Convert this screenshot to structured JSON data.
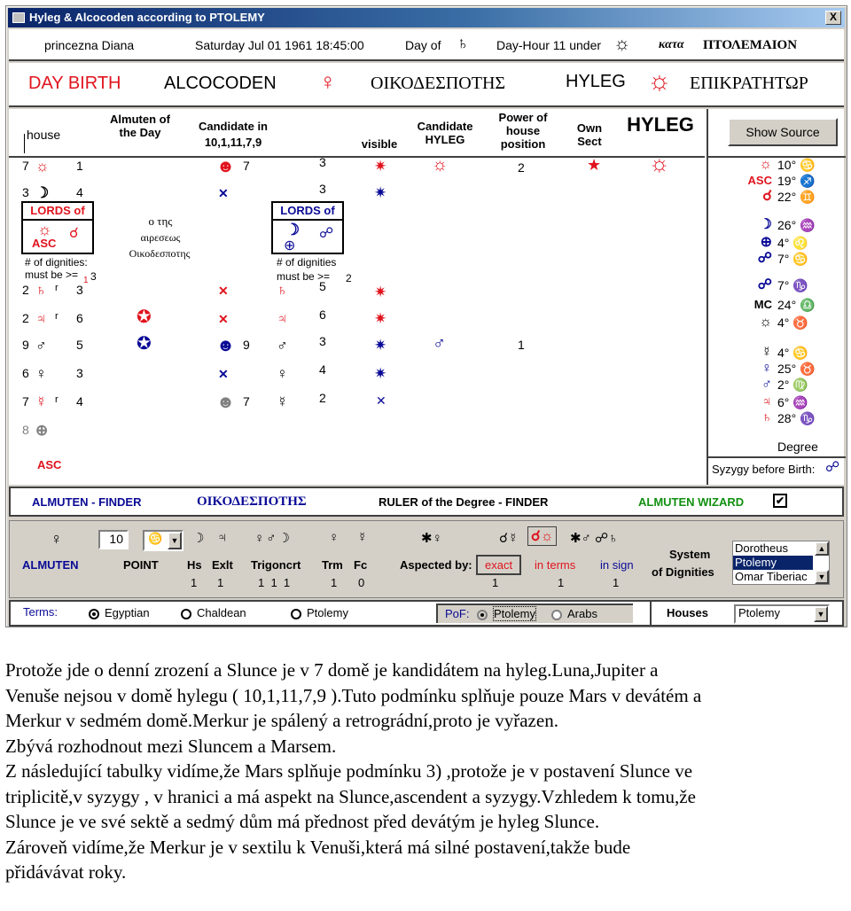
{
  "window": {
    "title": "Hyleg & Alcocoden according to PTOLEMY",
    "close_label": "X"
  },
  "infobar": {
    "name": "princezna Diana",
    "datetime": "Saturday Jul 01 1961 18:45:00",
    "day_of_label": "Day of",
    "day_ruler_icon": "saturn-icon",
    "day_ruler_glyph": "♄",
    "day_hour": "Day-Hour 11 under",
    "hour_ruler_icon": "sun-icon",
    "hour_ruler_glyph": "☼",
    "kata": "κατα",
    "ptolemaion": "ΠΤΟΛΕΜΑΙΟΝ"
  },
  "headbar": {
    "day_birth": "DAY BIRTH",
    "alcocoden": "ALCOCODEN",
    "oikodespotes_icon_glyph": "♀",
    "oikodespotes": "ΟΙΚΟΔΕΣΠΟΤΗΣ",
    "hyleg": "HYLEG",
    "epikratetor_icon_glyph": "☼",
    "epikratetor": "ΕΠΙΚΡΑΤΗΤΩΡ"
  },
  "table": {
    "headers": {
      "house": "house",
      "almuten_day": "Almuten of the Day",
      "candidate_in": "Candidate in",
      "candidate_houses": "10,1,11,7,9",
      "visible": "visible",
      "candidate_hyleg": "Candidate HYLEG",
      "power_house": "Power of house position",
      "own_sect": "Own Sect",
      "hyleg": "HYLEG"
    },
    "show_source_label": "Show Source",
    "lords_of_label": "LORDS of",
    "asc_label": "ASC",
    "dignities_label": "# of dignities:",
    "must_be_left": "must be >=",
    "must_be_left_value": "3",
    "must_be_left_sub": "1",
    "dignities_label_right": "# of dignities",
    "must_be_right": "must be >=",
    "must_be_right_value": "2",
    "greek_1": "ο της",
    "greek_2": "αιρεσεως",
    "greek_3": "Οικοδεσποτης",
    "left_rows": [
      {
        "house": "7",
        "planet": "sun",
        "glyph": "☼",
        "retro": "",
        "score": "1",
        "color": "red"
      },
      {
        "house": "3",
        "planet": "moon",
        "glyph": "☽",
        "retro": "",
        "score": "4",
        "color": "black"
      },
      {
        "house": "2",
        "planet": "saturn",
        "glyph": "♄",
        "retro": "r",
        "score": "3",
        "color": "red"
      },
      {
        "house": "2",
        "planet": "jupiter",
        "glyph": "♃",
        "retro": "r",
        "score": "6",
        "color": "red"
      },
      {
        "house": "9",
        "planet": "mars",
        "glyph": "♂",
        "retro": "",
        "score": "5",
        "color": "black"
      },
      {
        "house": "6",
        "planet": "venus",
        "glyph": "♀",
        "retro": "",
        "score": "3",
        "color": "black"
      },
      {
        "house": "7",
        "planet": "mercury",
        "glyph": "☿",
        "retro": "r",
        "score": "4",
        "color": "red"
      },
      {
        "house": "8",
        "planet": "part-of-fortune",
        "glyph": "⊕",
        "retro": "",
        "score": "",
        "color": "gray"
      }
    ],
    "asc_bottom": "ASC",
    "candidate_rows": [
      {
        "mark": "smiley",
        "house": "7",
        "planet_glyph": "",
        "score": "3"
      },
      {
        "mark": "x",
        "house": "",
        "planet_glyph": "",
        "score": "3"
      },
      {
        "mark": "x",
        "house": "",
        "planet_glyph": "♄",
        "score": "5"
      },
      {
        "mark": "x",
        "house": "",
        "planet_glyph": "♃",
        "score": "6"
      },
      {
        "mark": "smiley",
        "house": "9",
        "planet_glyph": "♂",
        "score": "3"
      },
      {
        "mark": "x",
        "house": "",
        "planet_glyph": "♀",
        "score": "4"
      },
      {
        "mark": "smiley-gray",
        "house": "7",
        "planet_glyph": "☿",
        "score": "2"
      }
    ],
    "candidate_hyleg_row": {
      "glyph": "☼",
      "power": "2",
      "own_sect": "★"
    },
    "mars_candidate": {
      "glyph": "♂",
      "power": "1"
    },
    "positions": [
      {
        "label": "sun",
        "glyph": "☼",
        "degree": "10°",
        "sign": "♋",
        "color": "red"
      },
      {
        "label": "ASC",
        "glyph": "ASC",
        "degree": "19°",
        "sign": "♐",
        "color": "red"
      },
      {
        "label": "new-moon",
        "glyph": "☌",
        "degree": "22°",
        "sign": "♊",
        "color": "red"
      },
      {
        "label": "moon",
        "glyph": "☽",
        "degree": "26°",
        "sign": "♒",
        "color": "blue"
      },
      {
        "label": "part-of-fortune",
        "glyph": "⊕",
        "degree": "4°",
        "sign": "♌",
        "color": "blue"
      },
      {
        "label": "syzygy",
        "glyph": "☍",
        "degree": "7°",
        "sign": "♋",
        "color": "blue"
      },
      {
        "label": "full-moon",
        "glyph": "☍",
        "degree": "7°",
        "sign": "♑",
        "color": "blue"
      },
      {
        "label": "MC",
        "glyph": "MC",
        "degree": "24°",
        "sign": "♎",
        "color": "black"
      },
      {
        "label": "hour-ruler",
        "glyph": "☼",
        "degree": "4°",
        "sign": "♉",
        "color": "black"
      },
      {
        "label": "mercury",
        "glyph": "☿",
        "degree": "4°",
        "sign": "♋",
        "color": "black"
      },
      {
        "label": "venus",
        "glyph": "♀",
        "degree": "25°",
        "sign": "♉",
        "color": "blue"
      },
      {
        "label": "mars",
        "glyph": "♂",
        "degree": "2°",
        "sign": "♍",
        "color": "blue"
      },
      {
        "label": "jupiter",
        "glyph": "♃",
        "degree": "6°",
        "sign": "♒",
        "color": "red"
      },
      {
        "label": "saturn",
        "glyph": "♄",
        "degree": "28°",
        "sign": "♑",
        "color": "red"
      }
    ],
    "degree_label": "Degree",
    "syzygy_label": "Syzygy before Birth:",
    "syzygy_glyph": "☍"
  },
  "finder": {
    "almuten_finder": "ALMUTEN - FINDER",
    "oikodespotes": "ΟΙΚΟΔΕΣΠΟΤΗΣ",
    "ruler_degree": "RULER of the Degree - FINDER",
    "wizard": "ALMUTEN WIZARD",
    "wizard_checked": true
  },
  "controls": {
    "almuten_glyph": "♀",
    "almuten_label": "ALMUTEN",
    "point_value": "10",
    "point_sign": "♋",
    "point_label": "POINT",
    "hs_glyph": "☽",
    "exlt_glyph": "♃",
    "trig_glyphs": "♀♂☽",
    "trm_glyph": "♀",
    "fc_glyph": "☿",
    "hs_label": "Hs",
    "exlt_label": "Exlt",
    "trig_label": "Trigoncrt",
    "trm_label": "Trm",
    "fc_label": "Fc",
    "hs_val": "1",
    "exlt_val": "1",
    "trig_vals": "1  1  1",
    "trm_val": "1",
    "fc_val": "0",
    "aspected_by_label": "Aspected by:",
    "aspect_glyphs_1": "✱♀",
    "aspect_glyphs_2": "☌☿",
    "aspect_glyphs_3": "☌☼",
    "aspect_glyphs_4": "✱♂ ☍♄",
    "exact_label": "exact",
    "in_terms_label": "in terms",
    "in_sign_label": "in sign",
    "exact_val": "1",
    "in_terms_val": "1",
    "in_sign_val": "1",
    "system_label_1": "System",
    "system_label_2": "of Dignities",
    "system_options": [
      "Dorotheus",
      "Ptolemy",
      "Omar Tiberiac"
    ],
    "system_selected": "Ptolemy"
  },
  "terms": {
    "label": "Terms:",
    "options": [
      "Egyptian",
      "Chaldean",
      "Ptolemy"
    ],
    "selected": "Egyptian",
    "pof_label": "PoF:",
    "pof_options": [
      "Ptolemy",
      "Arabs"
    ],
    "pof_selected": "Ptolemy",
    "houses_label": "Houses",
    "houses_value": "Ptolemy"
  },
  "body_text": [
    "Protože jde o denní zrození a Slunce je v 7 domě je kandidátem na hyleg.Luna,Jupiter a",
    "Venuše nejsou v domě hylegu ( 10,1,11,7,9 ).Tuto podmínku splňuje pouze Mars v devátém a",
    "Merkur v sedmém domě.Merkur je spálený a retrográdní,proto je vyřazen.",
    "Zbývá rozhodnout mezi Sluncem a Marsem.",
    "Z následující tabulky vidíme,že Mars splňuje podmínku 3) ,protože je v postavení Slunce ve",
    "triplicitě,v syzygy , v hranici a má aspekt na Slunce,ascendent a syzygy.Vzhledem k tomu,že",
    "Slunce je ve své sektě a sedmý dům má přednost před devátým je hyleg Slunce.",
    "Zároveň vidíme,že Merkur je v sextilu k Venuši,která má silné postavení,takže bude",
    "přidávávat roky."
  ]
}
